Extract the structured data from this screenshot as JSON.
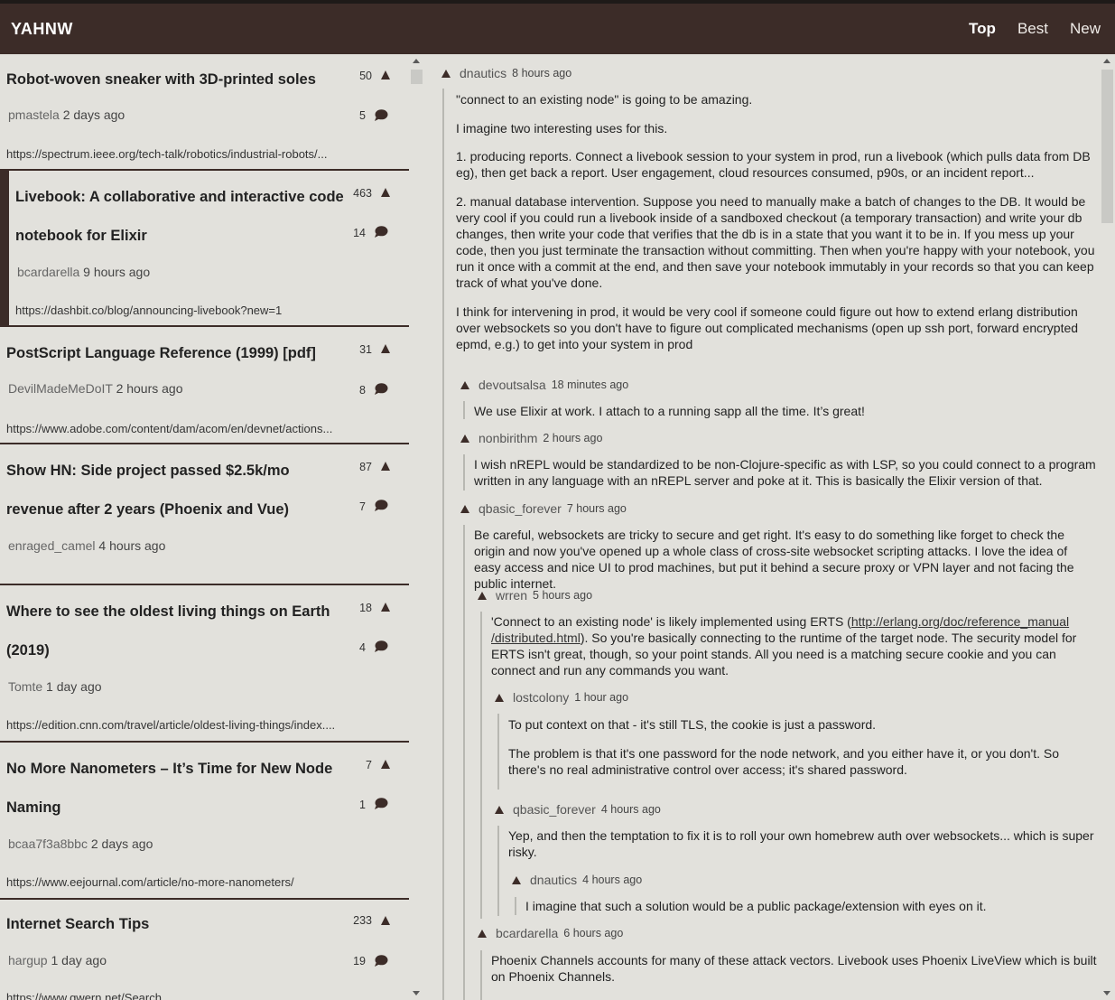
{
  "app": {
    "brand": "YAHNW",
    "nav": [
      "Top",
      "Best",
      "New"
    ],
    "active_nav": "Top"
  },
  "stories": [
    {
      "title": "Robot-woven sneaker with 3D-printed soles",
      "user": "pmastela",
      "age": "2 days ago",
      "score": "50",
      "comments": "5",
      "url": "https://spectrum.ieee.org/tech-talk/robotics/industrial-robots/..."
    },
    {
      "title": "Livebook: A collaborative and interactive code notebook for Elixir",
      "user": "bcardarella",
      "age": "9 hours ago",
      "score": "463",
      "comments": "14",
      "url": "https://dashbit.co/blog/announcing-livebook?new=1"
    },
    {
      "title": "PostScript Language Reference (1999) [pdf]",
      "user": "DevilMadeMeDoIT",
      "age": "2 hours ago",
      "score": "31",
      "comments": "8",
      "url": "https://www.adobe.com/content/dam/acom/en/devnet/actions..."
    },
    {
      "title": "Show HN: Side project passed $2.5k/mo revenue after 2 years (Phoenix and Vue)",
      "user": "enraged_camel",
      "age": "4 hours ago",
      "score": "87",
      "comments": "7",
      "url": ""
    },
    {
      "title": "Where to see the oldest living things on Earth (2019)",
      "user": "Tomte",
      "age": "1 day ago",
      "score": "18",
      "comments": "4",
      "url": "https://edition.cnn.com/travel/article/oldest-living-things/index...."
    },
    {
      "title": "No More Nanometers – It’s Time for New Node Naming",
      "user": "bcaa7f3a8bbc",
      "age": "2 days ago",
      "score": "7",
      "comments": "1",
      "url": "https://www.eejournal.com/article/no-more-nanometers/"
    },
    {
      "title": "Internet Search Tips",
      "user": "hargup",
      "age": "1 day ago",
      "score": "233",
      "comments": "19",
      "url": "https://www.gwern.net/Search"
    }
  ],
  "comments": [
    {
      "user": "dnautics",
      "age": "8 hours ago",
      "paragraphs": [
        "\"connect to an existing node\" is going to be amazing.",
        "I imagine two interesting uses for this.",
        "1. producing reports. Connect a livebook session to your system in prod, run a livebook (which pulls data from DB eg), then get back a report. User engagement, cloud resources consumed, p90s, or an incident report...",
        "2. manual database intervention. Suppose you need to manually make a batch of changes to the DB. It would be very cool if you could run a livebook inside of a sandboxed checkout (a temporary transaction) and write your db changes, then write your code that verifies that the db is in a state that you want it to be in. If you mess up your code, then you just terminate the transaction without committing. Then when you're happy with your notebook, you run it once with a commit at the end, and then save your notebook immutably in your records so that you can keep track of what you've done.",
        "I think for intervening in prod, it would be very cool if someone could figure out how to extend erlang distribution over websockets so you don't have to figure out complicated mechanisms (open up ssh port, forward encrypted epmd, e.g.) to get into your system in prod"
      ]
    },
    {
      "user": "devoutsalsa",
      "age": "18 minutes ago",
      "paragraphs": [
        "We use Elixir at work. I attach to a running sapp all the time. It’s great!"
      ]
    },
    {
      "user": "nonbirithm",
      "age": "2 hours ago",
      "paragraphs": [
        "I wish nREPL would be standardized to be non-Clojure-specific as with LSP, so you could connect to a program written in any language with an nREPL server and poke at it. This is basically the Elixir version of that."
      ]
    },
    {
      "user": "qbasic_forever",
      "age": "7 hours ago",
      "paragraphs": [
        "Be careful, websockets are tricky to secure and get right. It's easy to do something like forget to check the origin and now you've opened up a whole class of cross-site websocket scripting attacks. I love the idea of easy access and nice UI to prod machines, but put it behind a secure proxy or VPN layer and not facing the public internet."
      ]
    },
    {
      "user": "wrren",
      "age": "5 hours ago",
      "paragraphs": [
        "'Connect to an existing node' is likely implemented using ERTS (",
        "http://erlang.org/doc/reference_manual",
        "/distributed.html",
        "). So you're basically connecting to the runtime of the target node. The security model for ERTS isn't great, though, so your point stands. All you need is a matching secure cookie and you can connect and run any commands you want."
      ]
    },
    {
      "user": "lostcolony",
      "age": "1 hour ago",
      "paragraphs": [
        "To put context on that - it's still TLS, the cookie is just a password.",
        "The problem is that it's one password for the node network, and you either have it, or you don't. So there's no real administrative control over access; it's shared password."
      ]
    },
    {
      "user": "qbasic_forever",
      "age": "4 hours ago",
      "paragraphs": [
        "Yep, and then the temptation to fix it is to roll your own homebrew auth over websockets... which is super risky."
      ]
    },
    {
      "user": "dnautics",
      "age": "4 hours ago",
      "paragraphs": [
        "I imagine that such a solution would be a public package/extension with eyes on it."
      ]
    },
    {
      "user": "bcardarella",
      "age": "6 hours ago",
      "paragraphs": [
        "Phoenix Channels accounts for many of these attack vectors. Livebook uses Phoenix LiveView which is built on Phoenix Channels."
      ]
    }
  ]
}
